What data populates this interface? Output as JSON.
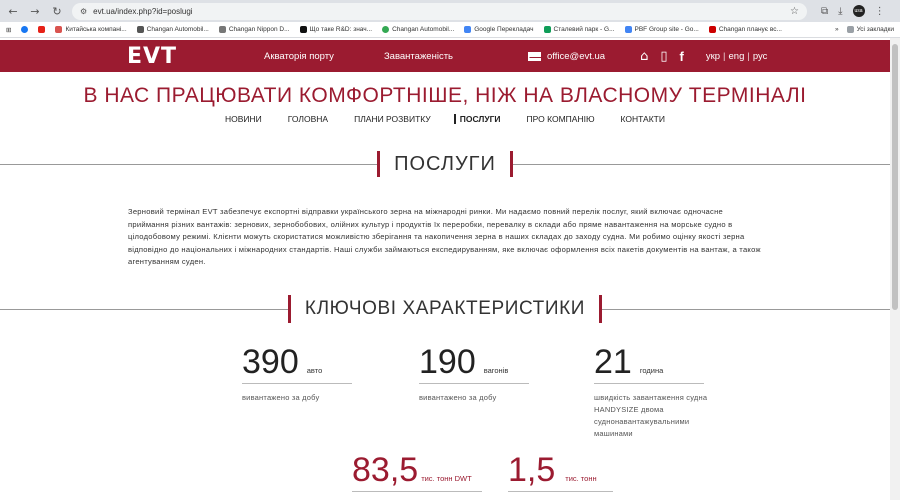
{
  "browser": {
    "url": "evt.ua/index.php?id=poslugi",
    "bookmarks": [
      "Китайська компані...",
      "Changan Automobil...",
      "Changan Nippon D...",
      "Що таке R&D: знач...",
      "Changan Automobil...",
      "Google Перекладач",
      "Сталевий парк - G...",
      "PBF Group site - Go...",
      "Changan планує вс..."
    ],
    "all_bookmarks": "Усі закладки"
  },
  "header": {
    "logo": "EVT",
    "link_aquatoria": "Акваторія порту",
    "link_load": "Завантаженість",
    "email": "office@evt.ua",
    "lang_ukr": "укр",
    "lang_eng": "eng",
    "lang_rus": "рус"
  },
  "slogan": "В НАС ПРАЦЮВАТИ КОМФОРТНІШЕ, НІЖ НА ВЛАСНОМУ ТЕРМІНАЛІ",
  "nav": {
    "news": "НОВИНИ",
    "home": "ГОЛОВНА",
    "plans": "ПЛАНИ РОЗВИТКУ",
    "services": "ПОСЛУГИ",
    "about": "ПРО КОМПАНІЮ",
    "contacts": "КОНТАКТИ"
  },
  "services": {
    "title": "ПОСЛУГИ",
    "text": "Зерновий термінал EVT забезпечує експортні відправки українського зерна на міжнародні ринки. Ми надаємо повний перелік послуг, який включає одночасне приймання різних вантажів: зернових, зернобобових, олійних культур і продуктів їх переробки, перевалку в склади або пряме навантаження на морське судно в цілодобовому режимі. Клієнти можуть скористатися можливістю зберігання та накопичення зерна в наших складах до заходу судна. Ми робимо оцінку якості зерна відповідно до національних і міжнародних стандартів. Наші служби займаються експедируванням, яке включає оформлення всіх пакетів документів на вантаж, а також агентуванням суден."
  },
  "key": {
    "title": "КЛЮЧОВІ ХАРАКТЕРИСТИКИ",
    "stats": [
      {
        "value": "390",
        "unit": "авто",
        "desc": "вивантажено за добу"
      },
      {
        "value": "190",
        "unit": "вагонів",
        "desc": "вивантажено за добу"
      },
      {
        "value": "21",
        "unit": "година",
        "desc": "швидкість завантаження судна HANDYSIZE двома суднонавантажувальними машинами"
      },
      {
        "value": "83,5",
        "unit": "тис. тонн DWT"
      },
      {
        "value": "1,5",
        "unit": "тис. тонн"
      }
    ]
  },
  "colors": {
    "brand": "#9b1b30"
  }
}
